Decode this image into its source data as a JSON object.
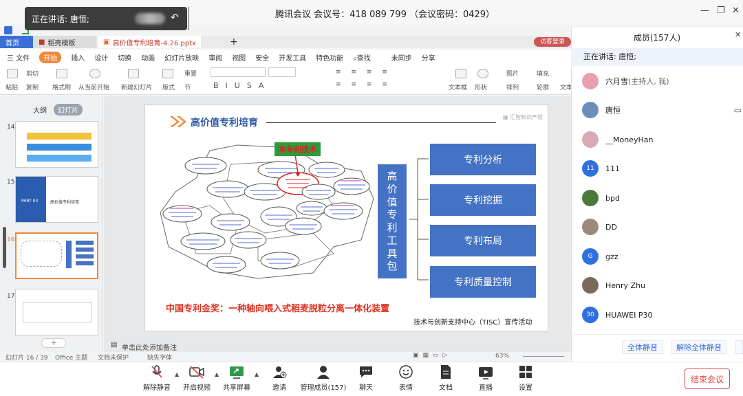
{
  "window": {
    "title": "腾讯会议 会议号：418 089 799 （会议密码：0429）",
    "speaking_toast": "正在讲话: 唐恒;"
  },
  "wps": {
    "tabs": [
      "首页",
      "稻壳模板",
      "高价值专利培育-4.26.pptx"
    ],
    "visitor_btn": "访客登录",
    "menus": [
      "三 文件",
      "开始",
      "插入",
      "设计",
      "切换",
      "动画",
      "幻灯片放映",
      "审阅",
      "视图",
      "安全",
      "开发工具",
      "特色功能",
      "查找"
    ],
    "menus_right": [
      "未同步",
      "分享"
    ],
    "ribbon_labels": {
      "paste": "粘贴",
      "cut": "剪切",
      "copy": "复制",
      "format_painter": "格式刷",
      "from_current": "从当前开始",
      "new_slide": "新建幻灯片",
      "layout": "版式",
      "reset": "重置",
      "section": "节",
      "text_box": "文本框",
      "shape": "形状",
      "picture": "图片",
      "arrange": "排列",
      "fill": "填充",
      "outline": "轮廓",
      "text": "文本"
    },
    "left_tabs": [
      "大纲",
      "幻灯片"
    ],
    "thumbnails": [
      {
        "num": "14"
      },
      {
        "num": "15",
        "text": "PART 03",
        "subtitle": "高价值专利培育"
      },
      {
        "num": "16"
      },
      {
        "num": "17"
      }
    ],
    "notes_placeholder": "单击此处添加备注",
    "status": {
      "slide_indicator": "幻灯片 16 / 39",
      "theme": "Office 主题",
      "doc_protect": "文档未保护",
      "font_missing": "缺失字体",
      "zoom": "63%"
    }
  },
  "slide": {
    "heading": "高价值专利培育",
    "logo_text": "汇智知识产权",
    "tag": "本专利技术",
    "toolkit_label": "高价值专利工具包",
    "toolkit_items": [
      "专利分析",
      "专利挖掘",
      "专利布局",
      "专利质量控制"
    ],
    "award": "中国专利金奖：一种轴向喂入式稻麦脱粒分离一体化装置",
    "footer": "技术与创新支持中心（TISC）宣传活动"
  },
  "panel": {
    "title": "成员(157人)",
    "speaking": "正在讲话: 唐恒;",
    "members": [
      {
        "name": "六月雪",
        "note": "(主持人, 我)",
        "avatar": "photo",
        "color": "#e8a0b0"
      },
      {
        "name": "唐恒",
        "note": "",
        "avatar": "photo",
        "color": "#6b8fb8"
      },
      {
        "name": "__MoneyHan",
        "note": "",
        "avatar": "photo",
        "color": "#d9a9b5"
      },
      {
        "name": "111",
        "note": "",
        "avatar": "11",
        "color": "#2f6fe0"
      },
      {
        "name": "bpd",
        "note": "",
        "avatar": "photo",
        "color": "#4a7a3a"
      },
      {
        "name": "DD",
        "note": "",
        "avatar": "photo",
        "color": "#9a8a7a"
      },
      {
        "name": "gzz",
        "note": "",
        "avatar": "G",
        "color": "#2f6fe0"
      },
      {
        "name": "Henry Zhu",
        "note": "",
        "avatar": "photo",
        "color": "#7a6a5a"
      },
      {
        "name": "HUAWEI P30",
        "note": "",
        "avatar": "30",
        "color": "#2f6fe0"
      }
    ],
    "mute_all": "全体静音",
    "unmute_all": "解除全体静音"
  },
  "toolbar": {
    "unmute": "解除静音",
    "video": "开启视频",
    "share": "共享屏幕",
    "invite": "邀请",
    "members": "管理成员(157)",
    "chat": "聊天",
    "emoji": "表情",
    "docs": "文档",
    "live": "直播",
    "settings": "设置",
    "end": "结束会议"
  },
  "colors": {
    "accent_blue": "#4472c4",
    "heading_blue": "#2e5aa8",
    "award_red": "#e0301e",
    "end_red": "#e04b4b",
    "orange_arrow": "#f0893a"
  }
}
